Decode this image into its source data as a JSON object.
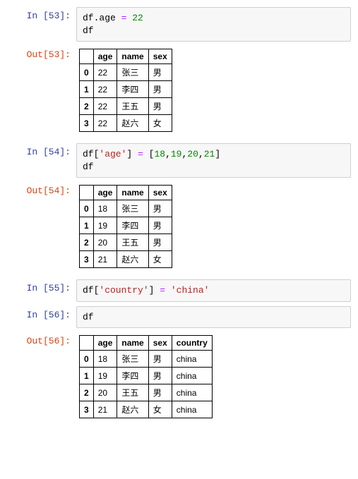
{
  "cells": {
    "c53": {
      "in_label": "In [53]:",
      "out_label": "Out[53]:",
      "code": {
        "line1_var": "df.age ",
        "line1_eq": "= ",
        "line1_val": "22",
        "line2": "df"
      },
      "table": {
        "headers": [
          "age",
          "name",
          "sex"
        ],
        "rows": [
          {
            "idx": "0",
            "age": "22",
            "name": "张三",
            "sex": "男"
          },
          {
            "idx": "1",
            "age": "22",
            "name": "李四",
            "sex": "男"
          },
          {
            "idx": "2",
            "age": "22",
            "name": "王五",
            "sex": "男"
          },
          {
            "idx": "3",
            "age": "22",
            "name": "赵六",
            "sex": "女"
          }
        ]
      }
    },
    "c54": {
      "in_label": "In [54]:",
      "out_label": "Out[54]:",
      "code": {
        "part1": "df[",
        "str1": "'age'",
        "part2": "] ",
        "eq": "= ",
        "part3": "[",
        "n1": "18",
        "c1": ",",
        "n2": "19",
        "c2": ",",
        "n3": "20",
        "c3": ",",
        "n4": "21",
        "part4": "]",
        "line2": "df"
      },
      "table": {
        "headers": [
          "age",
          "name",
          "sex"
        ],
        "rows": [
          {
            "idx": "0",
            "age": "18",
            "name": "张三",
            "sex": "男"
          },
          {
            "idx": "1",
            "age": "19",
            "name": "李四",
            "sex": "男"
          },
          {
            "idx": "2",
            "age": "20",
            "name": "王五",
            "sex": "男"
          },
          {
            "idx": "3",
            "age": "21",
            "name": "赵六",
            "sex": "女"
          }
        ]
      }
    },
    "c55": {
      "in_label": "In [55]:",
      "code": {
        "part1": "df[",
        "str1": "'country'",
        "part2": "] ",
        "eq": "= ",
        "str2": "'china'"
      }
    },
    "c56": {
      "in_label": "In [56]:",
      "out_label": "Out[56]:",
      "code": {
        "line1": "df"
      },
      "table": {
        "headers": [
          "age",
          "name",
          "sex",
          "country"
        ],
        "rows": [
          {
            "idx": "0",
            "age": "18",
            "name": "张三",
            "sex": "男",
            "country": "china"
          },
          {
            "idx": "1",
            "age": "19",
            "name": "李四",
            "sex": "男",
            "country": "china"
          },
          {
            "idx": "2",
            "age": "20",
            "name": "王五",
            "sex": "男",
            "country": "china"
          },
          {
            "idx": "3",
            "age": "21",
            "name": "赵六",
            "sex": "女",
            "country": "china"
          }
        ]
      }
    }
  }
}
